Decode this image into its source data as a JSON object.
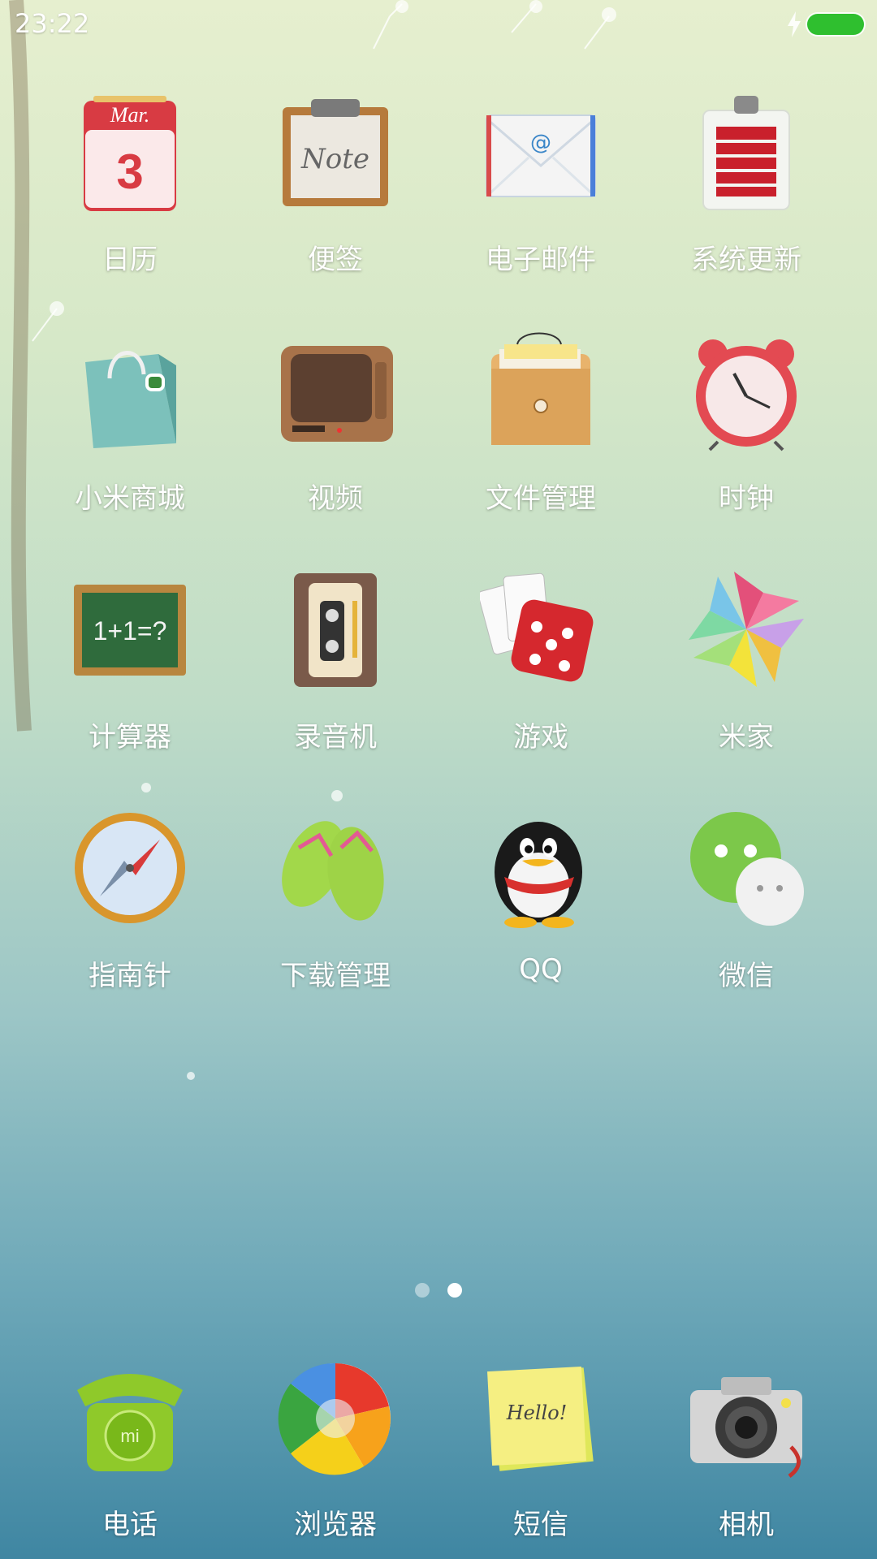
{
  "status_bar": {
    "time": "23:22"
  },
  "grid_apps": [
    {
      "label": "日历",
      "icon": "calendar-icon",
      "date_month": "Mar.",
      "date_day": "3"
    },
    {
      "label": "便签",
      "icon": "notes-icon",
      "note_text": "Note"
    },
    {
      "label": "电子邮件",
      "icon": "email-icon",
      "mail_symbol": "@"
    },
    {
      "label": "系统更新",
      "icon": "system-update-icon"
    },
    {
      "label": "小米商城",
      "icon": "mi-store-icon"
    },
    {
      "label": "视频",
      "icon": "video-tv-icon"
    },
    {
      "label": "文件管理",
      "icon": "file-manager-icon"
    },
    {
      "label": "时钟",
      "icon": "alarm-clock-icon"
    },
    {
      "label": "计算器",
      "icon": "calculator-icon",
      "board_text": "1+1=?"
    },
    {
      "label": "录音机",
      "icon": "recorder-cassette-icon"
    },
    {
      "label": "游戏",
      "icon": "games-dice-icon"
    },
    {
      "label": "米家",
      "icon": "mijia-pinwheel-icon"
    },
    {
      "label": "指南针",
      "icon": "compass-icon"
    },
    {
      "label": "下载管理",
      "icon": "download-flipflops-icon"
    },
    {
      "label": "QQ",
      "icon": "qq-penguin-icon"
    },
    {
      "label": "微信",
      "icon": "wechat-icon"
    }
  ],
  "page_indicator": {
    "pages": 2,
    "current": 2
  },
  "dock_apps": [
    {
      "label": "电话",
      "icon": "phone-icon",
      "phone_text": "mi"
    },
    {
      "label": "浏览器",
      "icon": "browser-ball-icon"
    },
    {
      "label": "短信",
      "icon": "sms-sticky-note-icon",
      "sticky_text": "Hello!"
    },
    {
      "label": "相机",
      "icon": "camera-icon"
    }
  ],
  "colors": {
    "battery": "#2fbf2f",
    "label_text": "#ffffff",
    "wallpaper_top": "#e6efcf",
    "wallpaper_bottom": "#3f86a2"
  }
}
